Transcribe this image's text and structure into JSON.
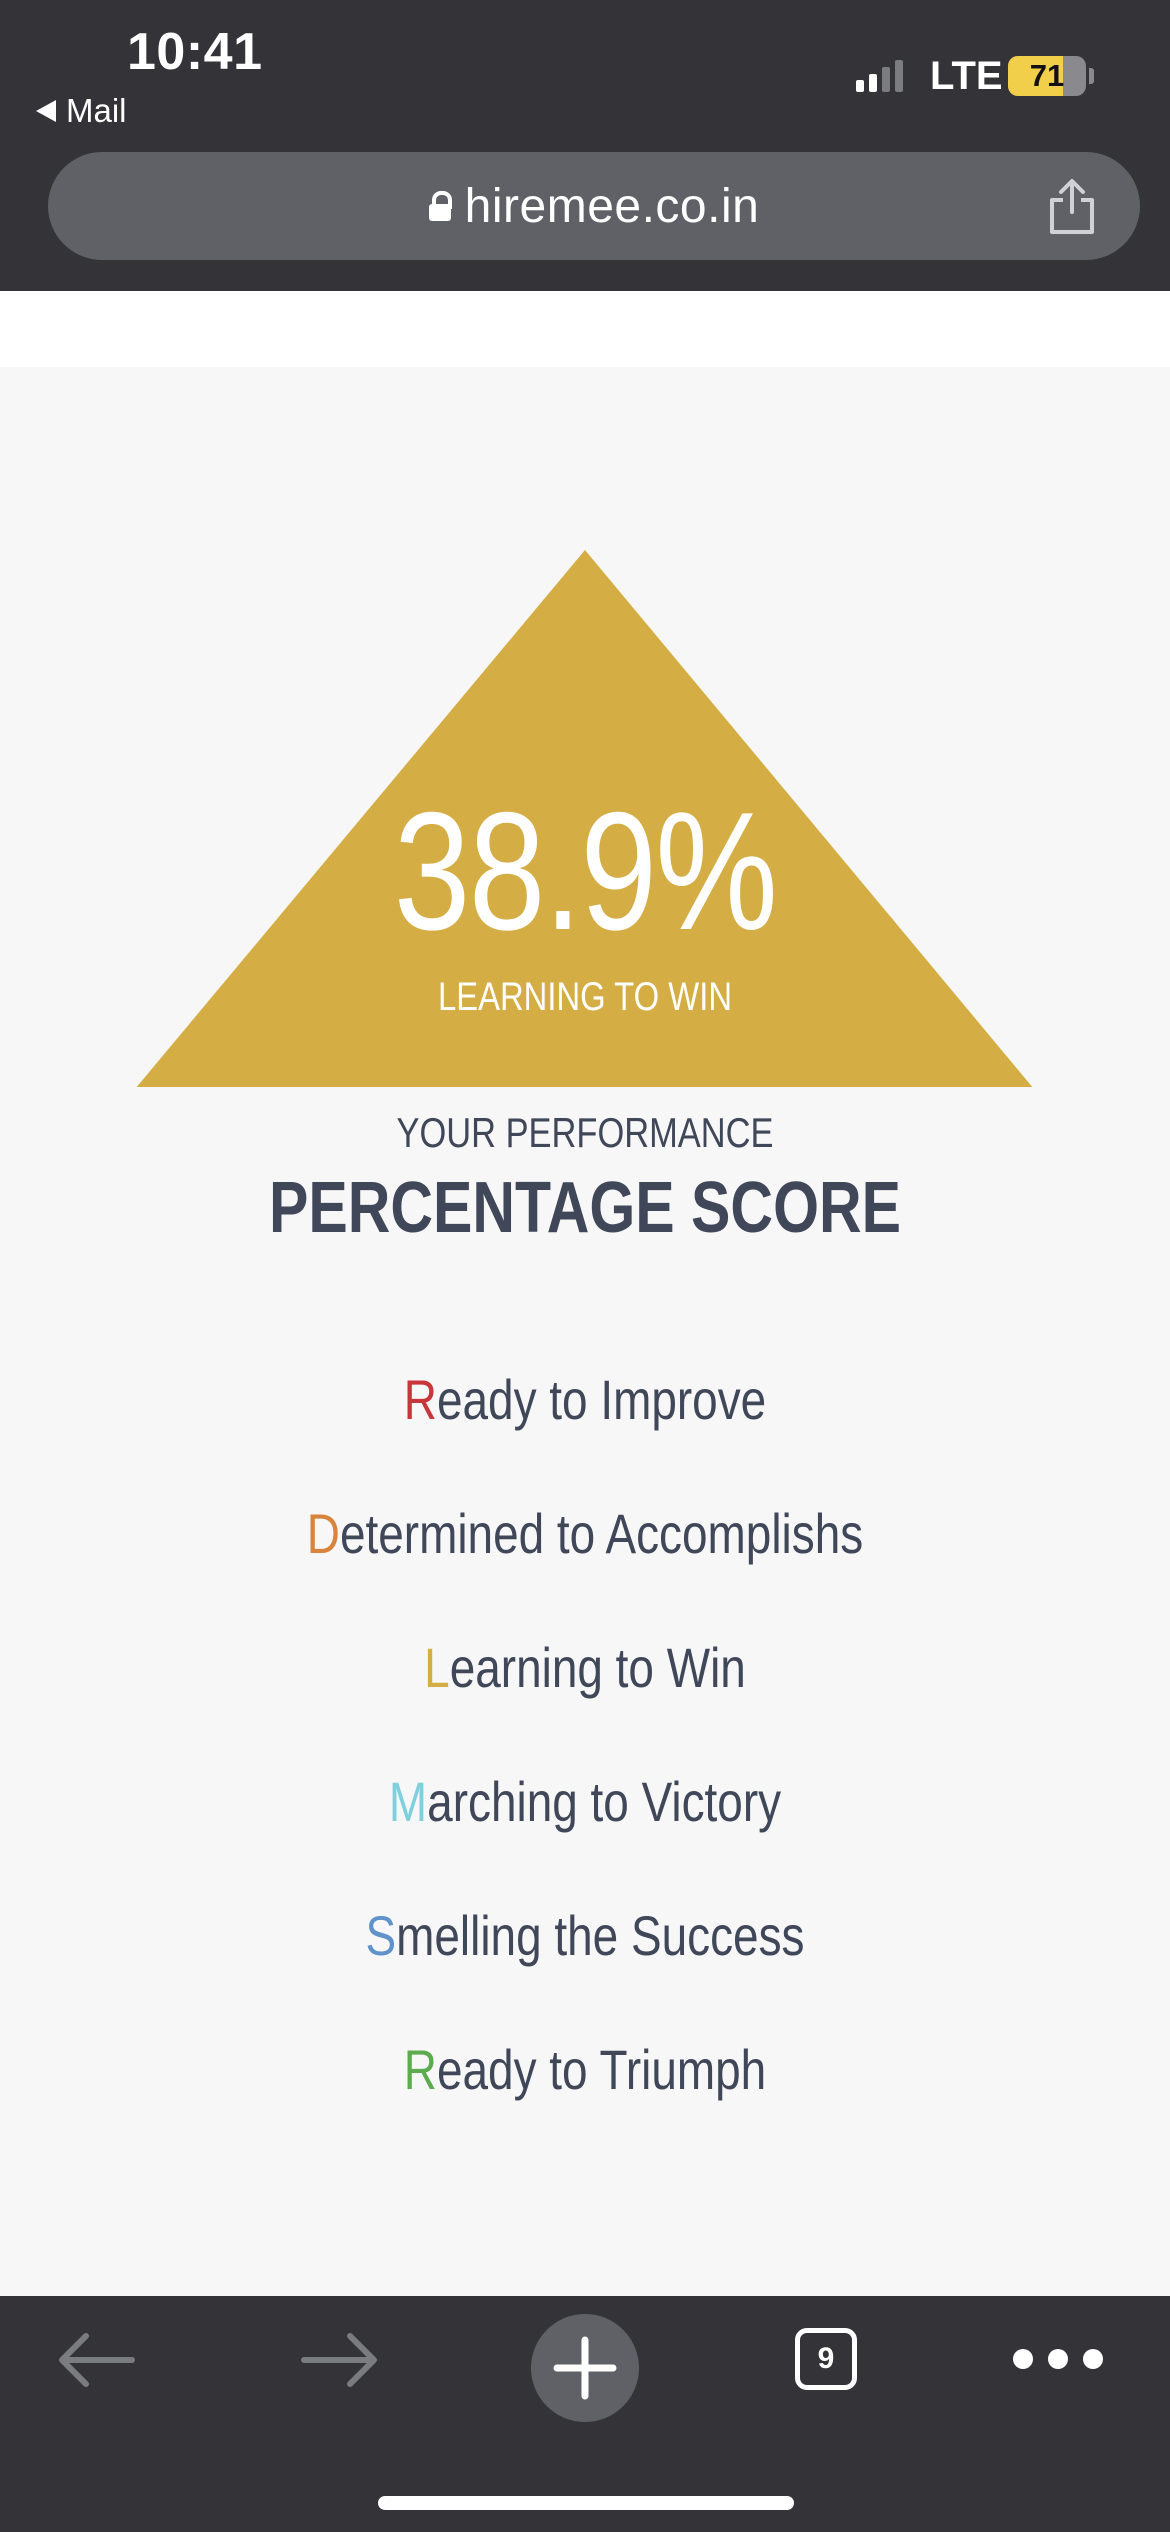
{
  "status_bar": {
    "time": "10:41",
    "back_app": "Mail",
    "network": "LTE",
    "battery_percent": "71",
    "battery_level": 0.71,
    "signal_bars_active": 2,
    "signal_bars_total": 4
  },
  "browser": {
    "url": "hiremee.co.in",
    "tab_count": "9",
    "icons": {
      "lock": "lock-icon",
      "share": "share-icon",
      "back": "arrow-left-icon",
      "forward": "arrow-right-icon",
      "new_tab": "plus-icon",
      "more": "ellipsis-icon"
    }
  },
  "score": {
    "value": "38.9%",
    "level_caption": "LEARNING TO WIN",
    "performance_label": "YOUR PERFORMANCE",
    "performance_title": "PERCENTAGE SCORE"
  },
  "levels": [
    {
      "initial": "R",
      "rest": "eady to Improve",
      "color": "#c8353a"
    },
    {
      "initial": "D",
      "rest": "etermined to Accomplishs",
      "color": "#d9843c"
    },
    {
      "initial": "L",
      "rest": "earning to Win",
      "color": "#d4ae45"
    },
    {
      "initial": "M",
      "rest": "arching to Victory",
      "color": "#7ed0dc"
    },
    {
      "initial": "S",
      "rest": "melling the Success",
      "color": "#5f93c9"
    },
    {
      "initial": "R",
      "rest": "eady to Triumph",
      "color": "#5dab4f"
    }
  ],
  "colors": {
    "chrome_bg": "#343438",
    "address_bg": "#5f6166",
    "triangle": "#d4ae45",
    "heading_text": "#3f4759",
    "page_bg": "#f7f7f7",
    "battery_fill": "#f2cf4a",
    "inactive_arrow": "#7b7c80"
  }
}
